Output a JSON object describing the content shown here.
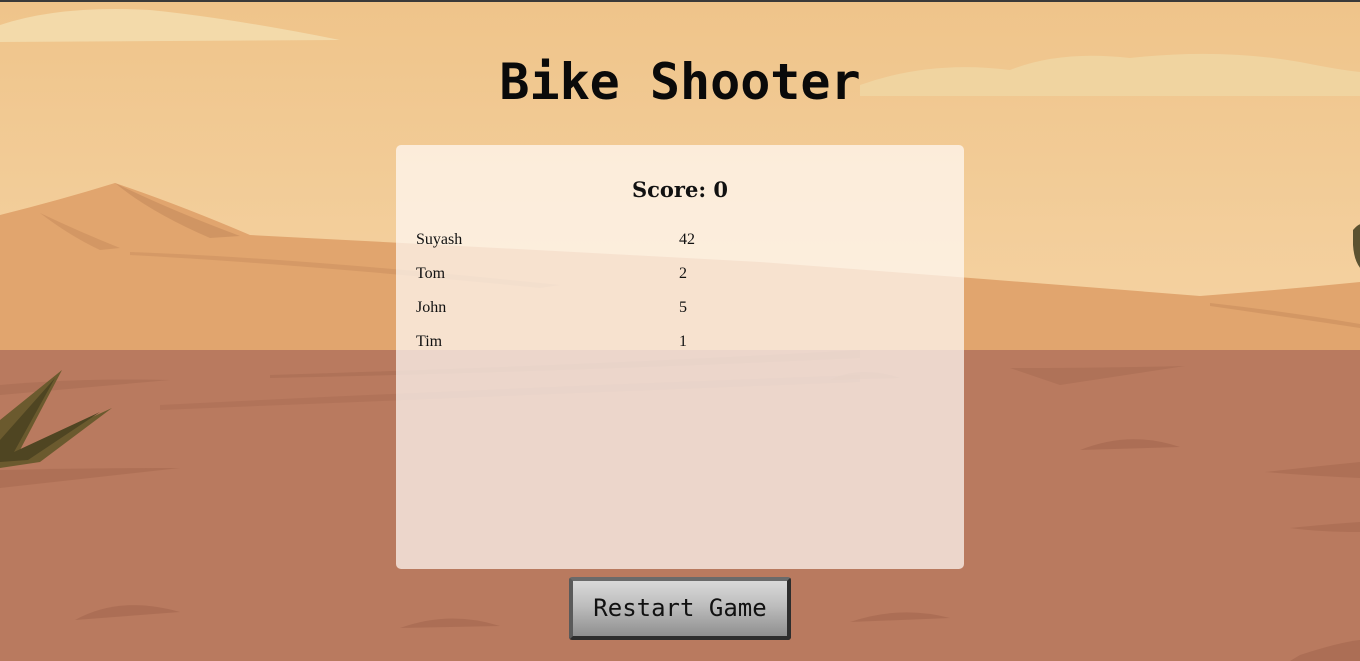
{
  "game": {
    "title": "Bike Shooter",
    "score_label": "Score: 0",
    "leaderboard": [
      {
        "name": "Suyash",
        "score": "42"
      },
      {
        "name": "Tom",
        "score": "2"
      },
      {
        "name": "John",
        "score": "5"
      },
      {
        "name": "Tim",
        "score": "1"
      }
    ],
    "restart_label": "Restart Game"
  },
  "colors": {
    "sky": "#f2c88f",
    "dunes": "#e2a46d",
    "ground": "#b97a5f",
    "shrub": "#6b5a2e"
  }
}
